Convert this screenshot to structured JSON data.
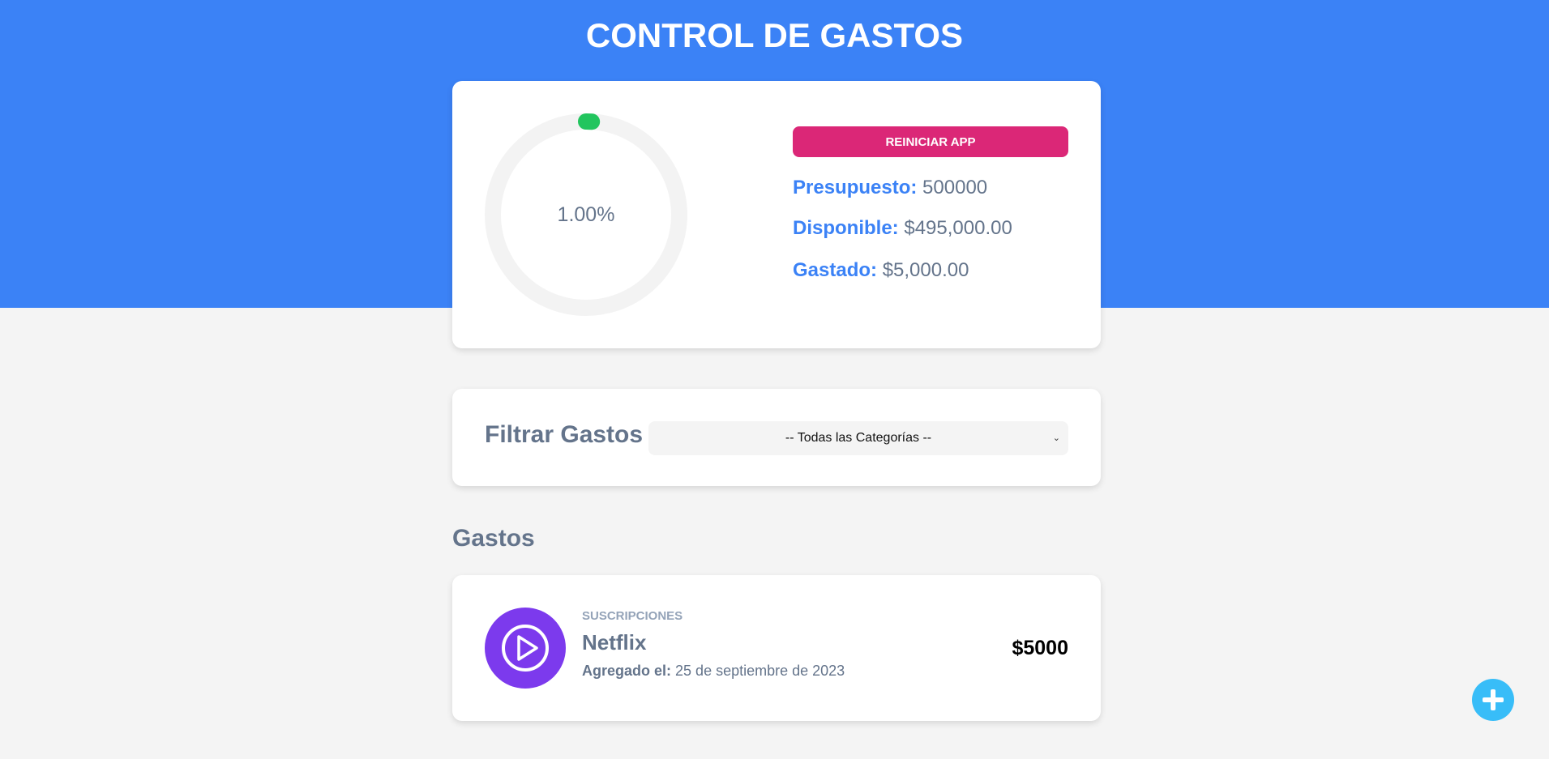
{
  "header": {
    "title": "CONTROL DE GASTOS"
  },
  "budget": {
    "progress_text": "1.00%",
    "progress_fraction": 0.01,
    "reset_label": "REINICIAR APP",
    "presupuesto_label": "Presupuesto:",
    "presupuesto_value": "500000",
    "disponible_label": "Disponible:",
    "disponible_value": "$495,000.00",
    "gastado_label": "Gastado:",
    "gastado_value": "$5,000.00"
  },
  "filter": {
    "label": "Filtrar Gastos",
    "selected_option": "-- Todas las Categorías --"
  },
  "expenses_section": {
    "title": "Gastos",
    "items": [
      {
        "category": "SUSCRIPCIONES",
        "name": "Netflix",
        "date_label": "Agregado el:",
        "date_value": "25 de septiembre de 2023",
        "amount": "$5000",
        "icon": "play-icon"
      }
    ]
  },
  "colors": {
    "header_bg": "#3b82f6",
    "accent": "#3b82f6",
    "reset_button": "#db2777",
    "progress": "#22c55e",
    "subscription_icon": "#7c3aed",
    "add_button": "#38bdf8"
  },
  "icons": {
    "add": "plus-icon"
  }
}
